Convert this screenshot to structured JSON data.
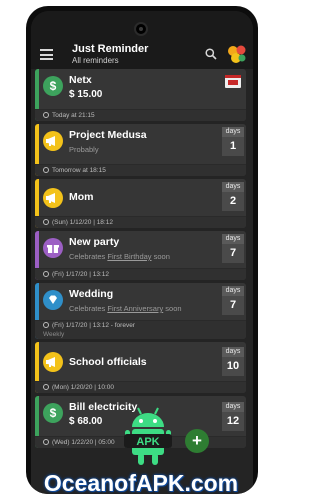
{
  "app": {
    "title": "Just Reminder",
    "subtitle": "All reminders"
  },
  "reminders": [
    {
      "name": "Netx",
      "amount": "$ 15.00",
      "footer": "Today at 21:15",
      "icon": "dollar-icon",
      "color": "#3da35d"
    },
    {
      "name": "Project Medusa",
      "subtitle": "Probably",
      "count_label": "days",
      "count": "1",
      "footer": "Tomorrow at 18:15",
      "icon": "megaphone-icon",
      "color": "#f3c21a"
    },
    {
      "name": "Mom",
      "count_label": "days",
      "count": "2",
      "footer": "(Sun) 1/12/20 | 18:12",
      "icon": "megaphone-icon",
      "color": "#f3c21a"
    },
    {
      "name": "New party",
      "subtitle_prefix": "Celebrates ",
      "subtitle_link": "First Birthday",
      "subtitle_suffix": " soon",
      "count_label": "days",
      "count": "7",
      "footer": "(Fri) 1/17/20 | 13:12",
      "icon": "gift-icon",
      "color": "#9c5fc4"
    },
    {
      "name": "Wedding",
      "subtitle_prefix": "Celebrates ",
      "subtitle_link": "First Anniversary",
      "subtitle_suffix": " soon",
      "count_label": "days",
      "count": "7",
      "footer": "(Fri) 1/17/20 | 13:12  -  forever",
      "footer2": "Weekly",
      "icon": "diamond-icon",
      "color": "#2f8fc9"
    },
    {
      "name": "School officials",
      "count_label": "days",
      "count": "10",
      "footer": "(Mon) 1/20/20 | 10:00",
      "icon": "megaphone-icon",
      "color": "#f3c21a"
    },
    {
      "name": "Bill electricity",
      "amount": "$ 68.00",
      "count_label": "days",
      "count": "12",
      "footer": "(Wed) 1/22/20 | 05:00",
      "icon": "dollar-icon",
      "color": "#3da35d"
    }
  ],
  "fab": {
    "label": "+"
  },
  "watermark": {
    "brand_text": "APK",
    "text": "OceanofAPK.com"
  }
}
